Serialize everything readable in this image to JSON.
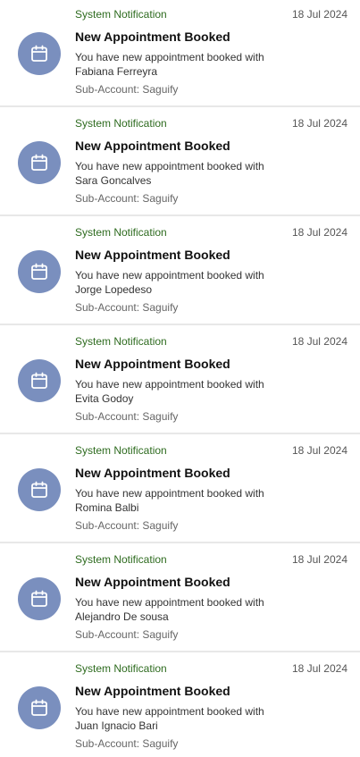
{
  "colors": {
    "source_text": "#2e6b1f",
    "avatar_bg": "#7a8fbe",
    "divider": "#e8e8e8"
  },
  "icons": {
    "avatar": "calendar-icon"
  },
  "notifications": [
    {
      "source": "System Notification",
      "date": "18 Jul 2024",
      "title": "New Appointment Booked",
      "body_line1": "You have new appointment booked with",
      "body_line2": "Fabiana Ferreyra",
      "sub_account": "Sub-Account: Saguify"
    },
    {
      "source": "System Notification",
      "date": "18 Jul 2024",
      "title": "New Appointment Booked",
      "body_line1": "You have new appointment booked with",
      "body_line2": "Sara Goncalves",
      "sub_account": "Sub-Account: Saguify"
    },
    {
      "source": "System Notification",
      "date": "18 Jul 2024",
      "title": "New Appointment Booked",
      "body_line1": "You have new appointment booked with",
      "body_line2": "Jorge Lopedeso",
      "sub_account": "Sub-Account: Saguify"
    },
    {
      "source": "System Notification",
      "date": "18 Jul 2024",
      "title": "New Appointment Booked",
      "body_line1": "You have new appointment booked with",
      "body_line2": "Evita Godoy",
      "sub_account": "Sub-Account: Saguify"
    },
    {
      "source": "System Notification",
      "date": "18 Jul 2024",
      "title": "New Appointment Booked",
      "body_line1": "You have new appointment booked with",
      "body_line2": "Romina Balbi",
      "sub_account": "Sub-Account: Saguify"
    },
    {
      "source": "System Notification",
      "date": "18 Jul 2024",
      "title": "New Appointment Booked",
      "body_line1": "You have new appointment booked with",
      "body_line2": "Alejandro De sousa",
      "sub_account": "Sub-Account: Saguify"
    },
    {
      "source": "System Notification",
      "date": "18 Jul 2024",
      "title": "New Appointment Booked",
      "body_line1": "You have new appointment booked with",
      "body_line2": "Juan Ignacio Bari",
      "sub_account": "Sub-Account: Saguify"
    }
  ]
}
